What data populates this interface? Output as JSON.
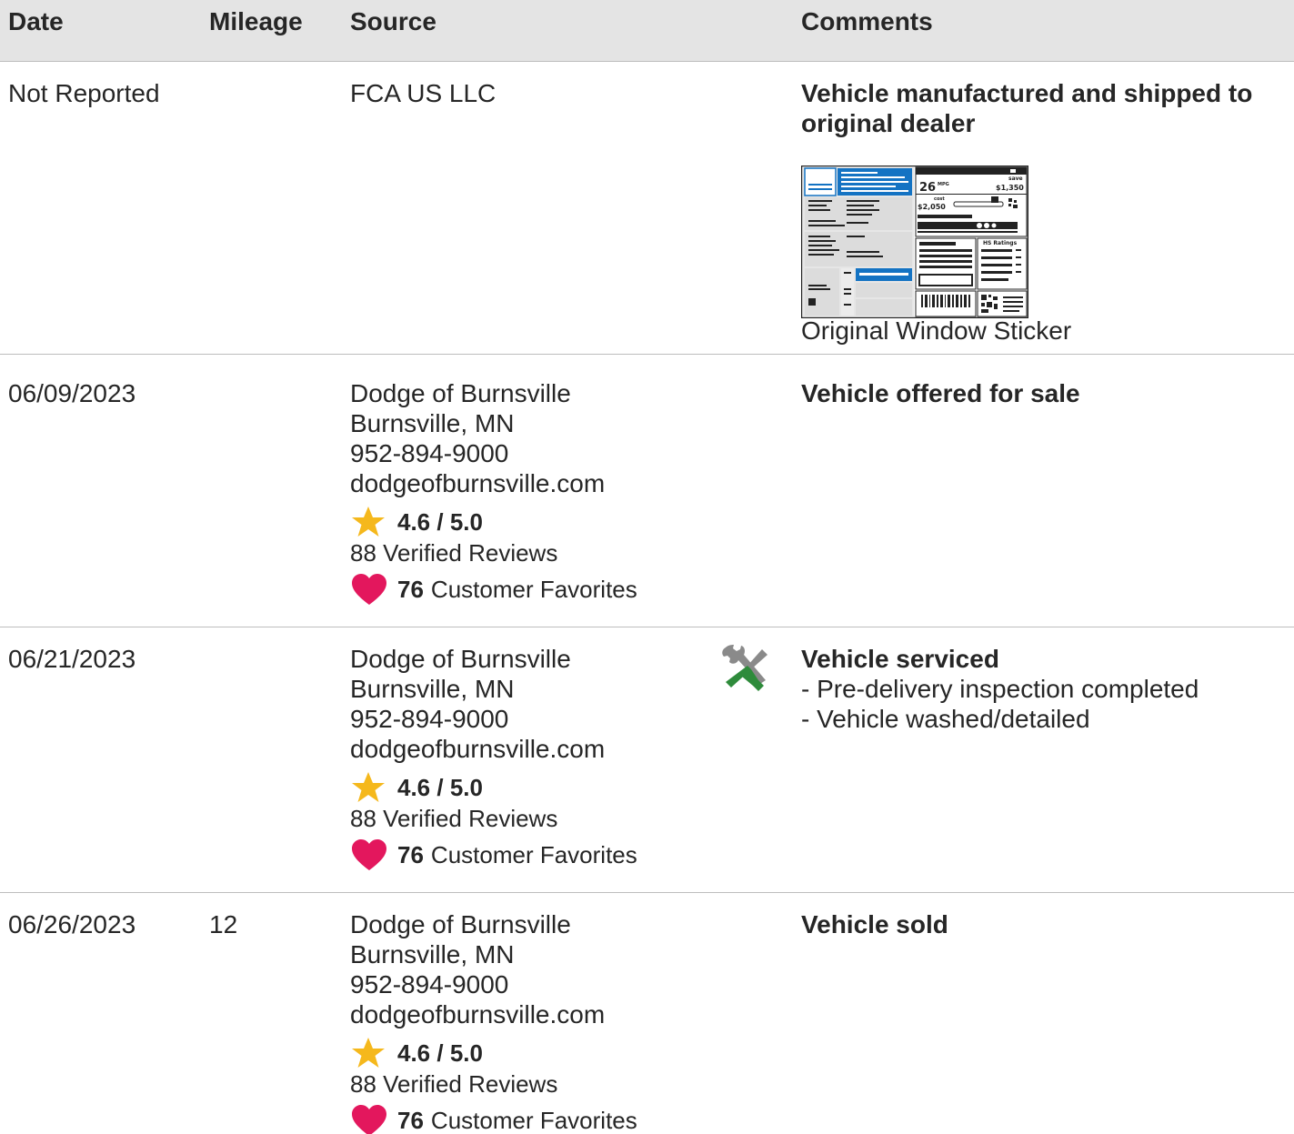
{
  "header": {
    "date": "Date",
    "mileage": "Mileage",
    "source": "Source",
    "comments": "Comments"
  },
  "rows": [
    {
      "date": "Not Reported",
      "mileage": "",
      "source_name": "FCA US LLC",
      "comment_title_line1": "Vehicle manufactured and shipped to",
      "comment_title_line2": "original dealer",
      "sticker_caption": "Original Window Sticker",
      "sticker": {
        "mpg": "26",
        "mpg_unit": "MPG",
        "save": "$1,350",
        "save_label": "save",
        "cost": "$2,050",
        "cost_label": "cost",
        "ratings_label": "HS Ratings"
      }
    },
    {
      "date": "06/09/2023",
      "mileage": "",
      "source_name": "Dodge of Burnsville",
      "source_location": "Burnsville, MN",
      "source_phone": "952-894-9000",
      "source_site": "dodgeofburnsville.com",
      "rating": "4.6 / 5.0",
      "reviews": "88 Verified Reviews",
      "favorites_count": "76",
      "favorites_label": "Customer Favorites",
      "comment_title": "Vehicle offered for sale"
    },
    {
      "date": "06/21/2023",
      "mileage": "",
      "source_name": "Dodge of Burnsville",
      "source_location": "Burnsville, MN",
      "source_phone": "952-894-9000",
      "source_site": "dodgeofburnsville.com",
      "rating": "4.6 / 5.0",
      "reviews": "88 Verified Reviews",
      "favorites_count": "76",
      "favorites_label": "Customer Favorites",
      "icon": "service-tools-icon",
      "comment_title": "Vehicle serviced",
      "comment_items": [
        "- Pre-delivery inspection completed",
        "- Vehicle washed/detailed"
      ]
    },
    {
      "date": "06/26/2023",
      "mileage": "12",
      "source_name": "Dodge of Burnsville",
      "source_location": "Burnsville, MN",
      "source_phone": "952-894-9000",
      "source_site": "dodgeofburnsville.com",
      "rating": "4.6 / 5.0",
      "reviews": "88 Verified Reviews",
      "favorites_count": "76",
      "favorites_label": "Customer Favorites",
      "comment_title": "Vehicle sold"
    }
  ],
  "colors": {
    "header_bg": "#e4e4e4",
    "divider": "#bdbdbd",
    "text": "#262626",
    "star": "#f5b81c",
    "heart": "#e3175d",
    "sticker_blue": "#1473c3",
    "wrench_green": "#2e8b3b"
  }
}
